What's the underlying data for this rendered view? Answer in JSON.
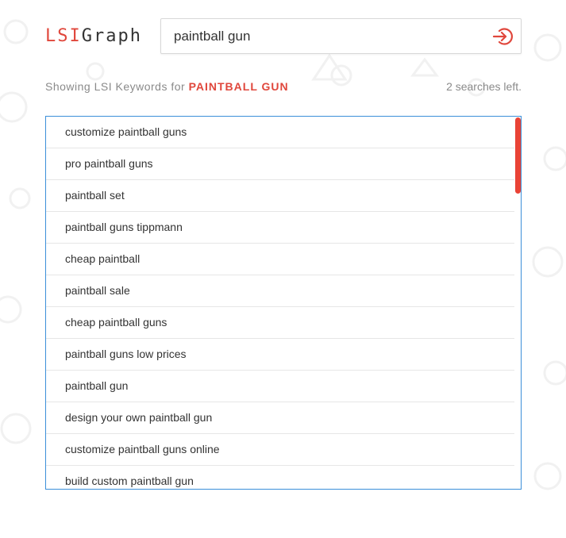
{
  "brand": {
    "part1": "LSI",
    "part2": "Graph"
  },
  "search": {
    "value": "paintball gun"
  },
  "meta": {
    "prefix": "Showing LSI Keywords for",
    "keyword": "PAINTBALL GUN",
    "searches_left": "2 searches left."
  },
  "results": [
    "customize paintball guns",
    "pro paintball guns",
    "paintball set",
    "paintball guns tippmann",
    "cheap paintball",
    "paintball sale",
    "cheap paintball guns",
    "paintball guns low prices",
    "paintball gun",
    "design your own paintball gun",
    "customize paintball guns online",
    "build custom paintball gun"
  ],
  "colors": {
    "accent": "#e0473c",
    "border": "#3b8fd9",
    "scroll": "#e94336"
  },
  "icons": {
    "go": "sign-in-arrow-icon"
  }
}
